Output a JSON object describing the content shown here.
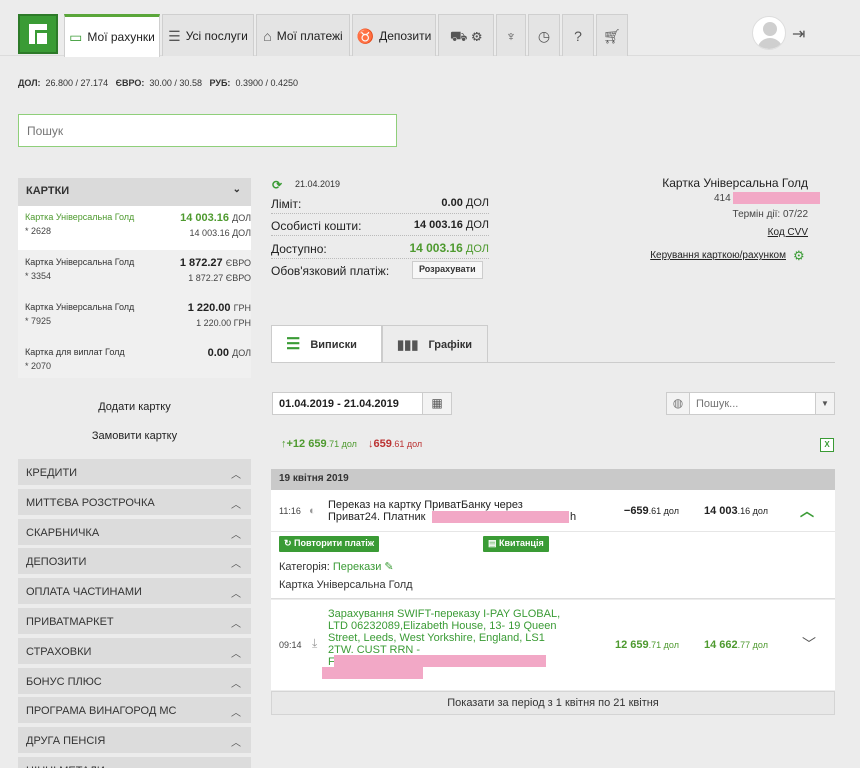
{
  "nav": {
    "tabs": [
      {
        "label": "Мої рахунки"
      },
      {
        "label": "Усі послуги"
      },
      {
        "label": "Мої платежі"
      },
      {
        "label": "Депозити"
      }
    ]
  },
  "rates": {
    "usd_label": "ДОЛ:",
    "usd": "26.800 / 27.174",
    "eur_label": "ЄВРО:",
    "eur": "30.00 / 30.58",
    "rub_label": "РУБ:",
    "rub": "0.3900 / 0.4250"
  },
  "search": {
    "placeholder": "Пошук"
  },
  "sidebar": {
    "cards_header": "КАРТКИ",
    "cards": [
      {
        "name": "Картка Універсальна Голд",
        "number": "* 2628",
        "balance": "14 003.16",
        "currency": "ДОЛ",
        "sub": "14 003.16 ДОЛ"
      },
      {
        "name": "Картка Універсальна Голд",
        "number": "* 3354",
        "balance": "1 872.27",
        "currency": "ЄВРО",
        "sub": "1 872.27 ЄВРО"
      },
      {
        "name": "Картка Універсальна Голд",
        "number": "* 7925",
        "balance": "1 220.00",
        "currency": "ГРН",
        "sub": "1 220.00 ГРН"
      },
      {
        "name": "Картка для виплат Голд",
        "number": "* 2070",
        "balance": "0.00",
        "currency": "ДОЛ",
        "sub": ""
      }
    ],
    "add_card": "Додати картку",
    "order_card": "Замовити картку",
    "sections": [
      "КРЕДИТИ",
      "МИТТЄВА РОЗСТРОЧКА",
      "СКАРБНИЧКА",
      "ДЕПОЗИТИ",
      "ОПЛАТА ЧАСТИНАМИ",
      "ПРИВАТМАРКЕТ",
      "СТРАХОВКИ",
      "БОНУС ПЛЮС",
      "ПРОГРАМА ВИНАГОРОД МС",
      "ДРУГА ПЕНСІЯ",
      "ЦІННІ МЕТАЛИ"
    ]
  },
  "detail": {
    "date": "21.04.2019",
    "limit_label": "Ліміт:",
    "limit": "0.00",
    "limit_cur": "ДОЛ",
    "own_label": "Особисті кошти:",
    "own": "14 003.16",
    "own_cur": "ДОЛ",
    "avail_label": "Доступно:",
    "avail": "14 003.16",
    "avail_cur": "ДОЛ",
    "mandatory_label": "Обов'язковий платіж:",
    "calc_button": "Розрахувати",
    "card_name": "Картка Універсальна Голд",
    "card_number_prefix": "414",
    "term": "Термін дії: 07/22",
    "cvv": "Код CVV",
    "manage": "Керування карткою/рахунком"
  },
  "tabs": {
    "statements": "Виписки",
    "charts": "Графіки"
  },
  "filter": {
    "date_range": "01.04.2019 - 21.04.2019",
    "search_placeholder": "Пошук..."
  },
  "totals": {
    "income_int": "+12 659",
    "income_dec": ".71 дол",
    "outcome_int": "659",
    "outcome_dec": ".61 дол"
  },
  "day_header": "19 квітня 2019",
  "transactions": [
    {
      "time": "11:16",
      "desc1": "Переказ на картку ПриватБанку через",
      "desc2": "Приват24. Платник",
      "desc2_tail": "h",
      "amount_int": "−659",
      "amount_dec": ".61 дол",
      "balance_int": "14 003",
      "balance_dec": ".16 дол",
      "repeat": "Повторити платіж",
      "receipt": "Квитанція",
      "category_label": "Категорія:",
      "category": "Перекази",
      "card": "Картка Універсальна Голд"
    },
    {
      "time": "09:14",
      "desc1": "Зарахування SWIFT-переказу I-PAY GLOBAL,",
      "desc2": "LTD 06232089,Elizabeth House, 13- 19 Queen",
      "desc3": "Street, Leeds, West Yorkshire, England, LS1",
      "desc4": "2TW. CUST RRN -",
      "desc5": "F",
      "amount_int": "12 659",
      "amount_dec": ".71 дол",
      "balance_int": "14 662",
      "balance_dec": ".77 дол"
    }
  ],
  "show_period": "Показати за період з 1 квітня по 21 квітня",
  "colors": {
    "brand_green": "#3a9b35",
    "accent_text_green": "#4e9a2f",
    "redact_pink": "#f2a8c6"
  }
}
